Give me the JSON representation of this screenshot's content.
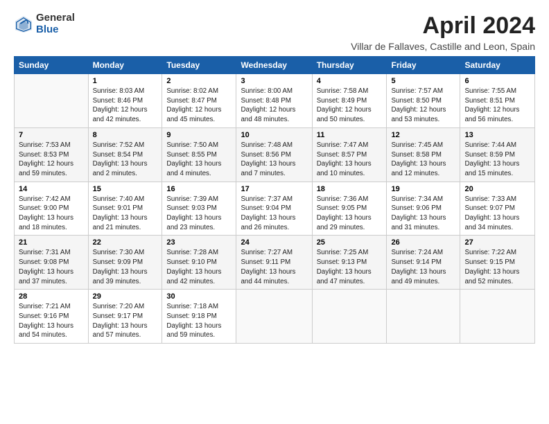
{
  "header": {
    "logo_general": "General",
    "logo_blue": "Blue",
    "title": "April 2024",
    "subtitle": "Villar de Fallaves, Castille and Leon, Spain"
  },
  "columns": [
    "Sunday",
    "Monday",
    "Tuesday",
    "Wednesday",
    "Thursday",
    "Friday",
    "Saturday"
  ],
  "weeks": [
    [
      {
        "day": "",
        "info": ""
      },
      {
        "day": "1",
        "info": "Sunrise: 8:03 AM\nSunset: 8:46 PM\nDaylight: 12 hours\nand 42 minutes."
      },
      {
        "day": "2",
        "info": "Sunrise: 8:02 AM\nSunset: 8:47 PM\nDaylight: 12 hours\nand 45 minutes."
      },
      {
        "day": "3",
        "info": "Sunrise: 8:00 AM\nSunset: 8:48 PM\nDaylight: 12 hours\nand 48 minutes."
      },
      {
        "day": "4",
        "info": "Sunrise: 7:58 AM\nSunset: 8:49 PM\nDaylight: 12 hours\nand 50 minutes."
      },
      {
        "day": "5",
        "info": "Sunrise: 7:57 AM\nSunset: 8:50 PM\nDaylight: 12 hours\nand 53 minutes."
      },
      {
        "day": "6",
        "info": "Sunrise: 7:55 AM\nSunset: 8:51 PM\nDaylight: 12 hours\nand 56 minutes."
      }
    ],
    [
      {
        "day": "7",
        "info": "Sunrise: 7:53 AM\nSunset: 8:53 PM\nDaylight: 12 hours\nand 59 minutes."
      },
      {
        "day": "8",
        "info": "Sunrise: 7:52 AM\nSunset: 8:54 PM\nDaylight: 13 hours\nand 2 minutes."
      },
      {
        "day": "9",
        "info": "Sunrise: 7:50 AM\nSunset: 8:55 PM\nDaylight: 13 hours\nand 4 minutes."
      },
      {
        "day": "10",
        "info": "Sunrise: 7:48 AM\nSunset: 8:56 PM\nDaylight: 13 hours\nand 7 minutes."
      },
      {
        "day": "11",
        "info": "Sunrise: 7:47 AM\nSunset: 8:57 PM\nDaylight: 13 hours\nand 10 minutes."
      },
      {
        "day": "12",
        "info": "Sunrise: 7:45 AM\nSunset: 8:58 PM\nDaylight: 13 hours\nand 12 minutes."
      },
      {
        "day": "13",
        "info": "Sunrise: 7:44 AM\nSunset: 8:59 PM\nDaylight: 13 hours\nand 15 minutes."
      }
    ],
    [
      {
        "day": "14",
        "info": "Sunrise: 7:42 AM\nSunset: 9:00 PM\nDaylight: 13 hours\nand 18 minutes."
      },
      {
        "day": "15",
        "info": "Sunrise: 7:40 AM\nSunset: 9:01 PM\nDaylight: 13 hours\nand 21 minutes."
      },
      {
        "day": "16",
        "info": "Sunrise: 7:39 AM\nSunset: 9:03 PM\nDaylight: 13 hours\nand 23 minutes."
      },
      {
        "day": "17",
        "info": "Sunrise: 7:37 AM\nSunset: 9:04 PM\nDaylight: 13 hours\nand 26 minutes."
      },
      {
        "day": "18",
        "info": "Sunrise: 7:36 AM\nSunset: 9:05 PM\nDaylight: 13 hours\nand 29 minutes."
      },
      {
        "day": "19",
        "info": "Sunrise: 7:34 AM\nSunset: 9:06 PM\nDaylight: 13 hours\nand 31 minutes."
      },
      {
        "day": "20",
        "info": "Sunrise: 7:33 AM\nSunset: 9:07 PM\nDaylight: 13 hours\nand 34 minutes."
      }
    ],
    [
      {
        "day": "21",
        "info": "Sunrise: 7:31 AM\nSunset: 9:08 PM\nDaylight: 13 hours\nand 37 minutes."
      },
      {
        "day": "22",
        "info": "Sunrise: 7:30 AM\nSunset: 9:09 PM\nDaylight: 13 hours\nand 39 minutes."
      },
      {
        "day": "23",
        "info": "Sunrise: 7:28 AM\nSunset: 9:10 PM\nDaylight: 13 hours\nand 42 minutes."
      },
      {
        "day": "24",
        "info": "Sunrise: 7:27 AM\nSunset: 9:11 PM\nDaylight: 13 hours\nand 44 minutes."
      },
      {
        "day": "25",
        "info": "Sunrise: 7:25 AM\nSunset: 9:13 PM\nDaylight: 13 hours\nand 47 minutes."
      },
      {
        "day": "26",
        "info": "Sunrise: 7:24 AM\nSunset: 9:14 PM\nDaylight: 13 hours\nand 49 minutes."
      },
      {
        "day": "27",
        "info": "Sunrise: 7:22 AM\nSunset: 9:15 PM\nDaylight: 13 hours\nand 52 minutes."
      }
    ],
    [
      {
        "day": "28",
        "info": "Sunrise: 7:21 AM\nSunset: 9:16 PM\nDaylight: 13 hours\nand 54 minutes."
      },
      {
        "day": "29",
        "info": "Sunrise: 7:20 AM\nSunset: 9:17 PM\nDaylight: 13 hours\nand 57 minutes."
      },
      {
        "day": "30",
        "info": "Sunrise: 7:18 AM\nSunset: 9:18 PM\nDaylight: 13 hours\nand 59 minutes."
      },
      {
        "day": "",
        "info": ""
      },
      {
        "day": "",
        "info": ""
      },
      {
        "day": "",
        "info": ""
      },
      {
        "day": "",
        "info": ""
      }
    ]
  ]
}
